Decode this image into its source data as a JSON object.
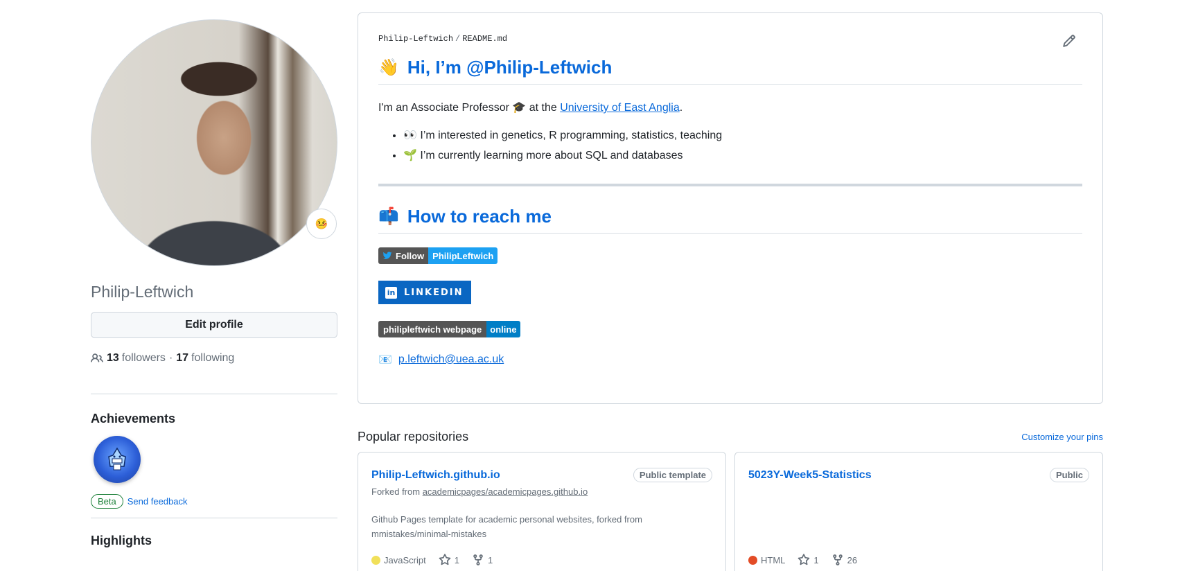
{
  "profile": {
    "username": "Philip-Leftwich",
    "status_emoji": "🤒",
    "edit_label": "Edit profile",
    "followers_count": "13",
    "followers_label": "followers",
    "separator": "·",
    "following_count": "17",
    "following_label": "following",
    "achievements_title": "Achievements",
    "beta_label": "Beta",
    "feedback_label": "Send feedback",
    "highlights_title": "Highlights"
  },
  "readme": {
    "owner": "Philip-Leftwich",
    "slash": "/",
    "file": "README.md",
    "greeting_emoji": "👋",
    "greeting": "Hi, I’m @Philip-Leftwich",
    "intro_before": "I'm an Associate Professor 🎓 at the ",
    "intro_link": "University of East Anglia",
    "intro_after": ".",
    "bullets": [
      "👀 I’m interested in genetics, R programming, statistics, teaching",
      "🌱 I’m currently learning more about SQL and databases"
    ],
    "reach_emoji": "📫",
    "reach_title": "How to reach me",
    "twitter_left": "Follow",
    "twitter_right": "PhilipLeftwich",
    "linkedin_label": "LINKEDIN",
    "linkedin_icon": "in",
    "web_left": "philipleftwich webpage",
    "web_right": "online",
    "email_emoji": "📧",
    "email": "p.leftwich@uea.ac.uk"
  },
  "repos": {
    "title": "Popular repositories",
    "customize": "Customize your pins",
    "items": [
      {
        "name": "Philip-Leftwich.github.io",
        "visibility": "Public template",
        "forked_prefix": "Forked from ",
        "forked_from": "academicpages/academicpages.github.io",
        "description": "Github Pages template for academic personal websites, forked from mmistakes/minimal-mistakes",
        "language": "JavaScript",
        "language_color": "#f1e05a",
        "stars": "1",
        "forks": "1"
      },
      {
        "name": "5023Y-Week5-Statistics",
        "visibility": "Public",
        "description": "",
        "language": "HTML",
        "language_color": "#e34c26",
        "stars": "1",
        "forks": "26"
      }
    ]
  },
  "colors": {
    "accent": "#0969da",
    "muted": "#636c76",
    "border": "#d0d7de"
  }
}
